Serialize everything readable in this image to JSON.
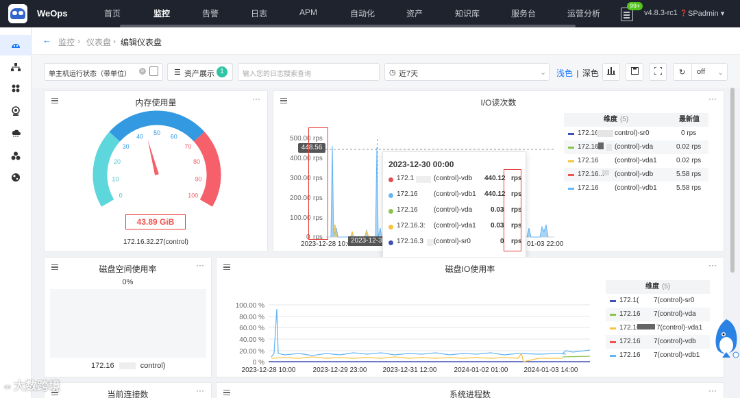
{
  "app": {
    "brand": "WeOps",
    "version": "v4.8.3-rc1",
    "user": "SPadmin",
    "notif_count": "99+"
  },
  "nav": [
    "首页",
    "监控",
    "告警",
    "日志",
    "APM",
    "自动化",
    "资产",
    "知识库",
    "服务台",
    "运营分析"
  ],
  "breadcrumb": {
    "item1": "监控",
    "item2": "仪表盘",
    "current": "编辑仪表盘"
  },
  "toolbar": {
    "dashboard_name": "单主机运行状态（带单位）",
    "asset_button": "资产展示",
    "asset_count": "1",
    "log_search_placeholder": "输入您的日志搜索查询",
    "time_range": "近7天",
    "theme_light": "浅色",
    "theme_sep": "|",
    "theme_dark": "深色",
    "refresh_value": "off"
  },
  "memory": {
    "title": "内存使用量",
    "value": "43.89  GiB",
    "host": "172.16.32.27(control)",
    "gauge_value": 43.89,
    "gauge_ticks": [
      "0",
      "10",
      "20",
      "30",
      "40",
      "50",
      "60",
      "70",
      "80",
      "90",
      "100"
    ]
  },
  "io": {
    "title": "I/O读次数",
    "y_labels": [
      "500.00",
      "400.00",
      "300.00",
      "200.00",
      "100.00",
      "0"
    ],
    "unit": "rps",
    "x_first": "2023-12-28 10:0",
    "x_last": "01-03 22:00",
    "crosshair_value": "448.56",
    "cursor_label": "2023-12-3",
    "legend_header_dim": "维度",
    "legend_header_count": "(5)",
    "legend_header_latest": "最新值",
    "legend": [
      {
        "host": "172.16",
        "name": "control)-sr0",
        "value": "0 rps",
        "color": "#3f51b5"
      },
      {
        "host": "172.16",
        "name": "(control)-vda",
        "value": "0.02 rps",
        "color": "#8bc34a"
      },
      {
        "host": "172.16",
        "name": "(control)-vda1",
        "value": "0.02 rps",
        "color": "#f9c23c"
      },
      {
        "host": "172.16...",
        "name": "(control)-vdb",
        "value": "5.58 rps",
        "color": "#ef5350"
      },
      {
        "host": "172.16",
        "name": "(control)-vdb1",
        "value": "5.58 rps",
        "color": "#64b5f6"
      }
    ],
    "tooltip": {
      "title": "2023-12-30 00:00",
      "rows": [
        {
          "host": "172.1",
          "name": "(control)-vdb",
          "value": "440.12",
          "unit": "rps",
          "color": "#e05050"
        },
        {
          "host": "172.16",
          "name": "(control)-vdb1",
          "value": "440.12",
          "unit": "rps",
          "color": "#64b5f6"
        },
        {
          "host": "172.16",
          "name": "(control)-vda",
          "value": "0.03",
          "unit": "rps",
          "color": "#8bc34a"
        },
        {
          "host": "172.16.3:",
          "name": "(control)-vda1",
          "value": "0.03",
          "unit": "rps",
          "color": "#f9c23c"
        },
        {
          "host": "172.16.3",
          "name": "(control)-sr0",
          "value": "0",
          "unit": "rps",
          "color": "#3f51b5"
        }
      ]
    }
  },
  "disk_space": {
    "title": "磁盘空间使用率",
    "percent": "0%",
    "host": "172.16",
    "host_tail": "control)"
  },
  "disk_io": {
    "title": "磁盘IO使用率",
    "y_labels": [
      "100.00 %",
      "80.00 %",
      "60.00 %",
      "40.00 %",
      "20.00 %",
      "0 %"
    ],
    "x_labels": [
      "2023-12-28 10:00",
      "2023-12-29 23:00",
      "2023-12-31 12:00",
      "2024-01-02 01:00",
      "2024-01-03 14:00"
    ],
    "legend_header_dim": "维度",
    "legend_header_count": "(5)",
    "legend": [
      {
        "host": "172.1(",
        "name": "7(control)-sr0",
        "color": "#3f51b5"
      },
      {
        "host": "172.16",
        "name": "7(control)-vda",
        "color": "#8bc34a"
      },
      {
        "host": "172.16",
        "name": "7(control)-vda1",
        "color": "#f9c23c"
      },
      {
        "host": "172.16",
        "name": "7(control)-vdb",
        "color": "#ef5350"
      },
      {
        "host": "172.16",
        "name": "7(control)-vdb1",
        "color": "#64b5f6"
      }
    ]
  },
  "bottom": {
    "left_title": "当前连接数",
    "right_title": "系统进程数"
  },
  "watermark": "大数跨境"
}
